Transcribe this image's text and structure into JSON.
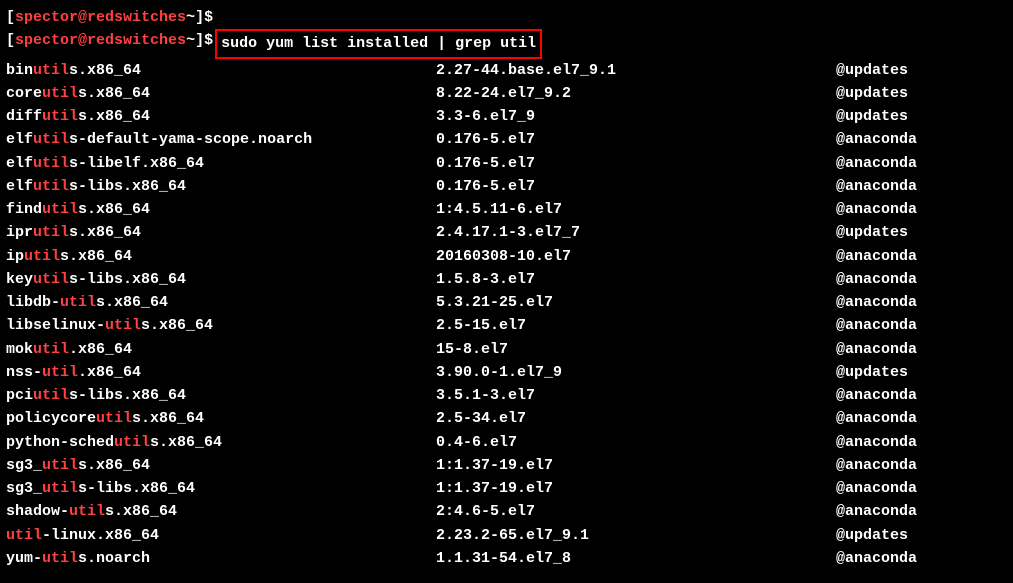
{
  "prompt": {
    "user": "spector",
    "host": "redswitches",
    "path": "~",
    "symbol": "$"
  },
  "command": "sudo yum list installed | grep util",
  "packages": [
    {
      "pre": "bin",
      "hl": "util",
      "post": "s.x86_64",
      "version": "2.27-44.base.el7_9.1",
      "repo": "@updates"
    },
    {
      "pre": "core",
      "hl": "util",
      "post": "s.x86_64",
      "version": "8.22-24.el7_9.2",
      "repo": "@updates"
    },
    {
      "pre": "diff",
      "hl": "util",
      "post": "s.x86_64",
      "version": "3.3-6.el7_9",
      "repo": "@updates"
    },
    {
      "pre": "elf",
      "hl": "util",
      "post": "s-default-yama-scope.noarch",
      "version": "0.176-5.el7",
      "repo": "@anaconda"
    },
    {
      "pre": "elf",
      "hl": "util",
      "post": "s-libelf.x86_64",
      "version": "0.176-5.el7",
      "repo": "@anaconda"
    },
    {
      "pre": "elf",
      "hl": "util",
      "post": "s-libs.x86_64",
      "version": "0.176-5.el7",
      "repo": "@anaconda"
    },
    {
      "pre": "find",
      "hl": "util",
      "post": "s.x86_64",
      "version": "1:4.5.11-6.el7",
      "repo": "@anaconda"
    },
    {
      "pre": "ipr",
      "hl": "util",
      "post": "s.x86_64",
      "version": "2.4.17.1-3.el7_7",
      "repo": "@updates"
    },
    {
      "pre": "ip",
      "hl": "util",
      "post": "s.x86_64",
      "version": "20160308-10.el7",
      "repo": "@anaconda"
    },
    {
      "pre": "key",
      "hl": "util",
      "post": "s-libs.x86_64",
      "version": "1.5.8-3.el7",
      "repo": "@anaconda"
    },
    {
      "pre": "libdb-",
      "hl": "util",
      "post": "s.x86_64",
      "version": "5.3.21-25.el7",
      "repo": "@anaconda"
    },
    {
      "pre": "libselinux-",
      "hl": "util",
      "post": "s.x86_64",
      "version": "2.5-15.el7",
      "repo": "@anaconda"
    },
    {
      "pre": "mok",
      "hl": "util",
      "post": ".x86_64",
      "version": "15-8.el7",
      "repo": "@anaconda"
    },
    {
      "pre": "nss-",
      "hl": "util",
      "post": ".x86_64",
      "version": "3.90.0-1.el7_9",
      "repo": "@updates"
    },
    {
      "pre": "pci",
      "hl": "util",
      "post": "s-libs.x86_64",
      "version": "3.5.1-3.el7",
      "repo": "@anaconda"
    },
    {
      "pre": "policycore",
      "hl": "util",
      "post": "s.x86_64",
      "version": "2.5-34.el7",
      "repo": "@anaconda"
    },
    {
      "pre": "python-sched",
      "hl": "util",
      "post": "s.x86_64",
      "version": "0.4-6.el7",
      "repo": "@anaconda"
    },
    {
      "pre": "sg3_",
      "hl": "util",
      "post": "s.x86_64",
      "version": "1:1.37-19.el7",
      "repo": "@anaconda"
    },
    {
      "pre": "sg3_",
      "hl": "util",
      "post": "s-libs.x86_64",
      "version": "1:1.37-19.el7",
      "repo": "@anaconda"
    },
    {
      "pre": "shadow-",
      "hl": "util",
      "post": "s.x86_64",
      "version": "2:4.6-5.el7",
      "repo": "@anaconda"
    },
    {
      "pre": "",
      "hl": "util",
      "post": "-linux.x86_64",
      "version": "2.23.2-65.el7_9.1",
      "repo": "@updates"
    },
    {
      "pre": "yum-",
      "hl": "util",
      "post": "s.noarch",
      "version": "1.1.31-54.el7_8",
      "repo": "@anaconda"
    }
  ]
}
